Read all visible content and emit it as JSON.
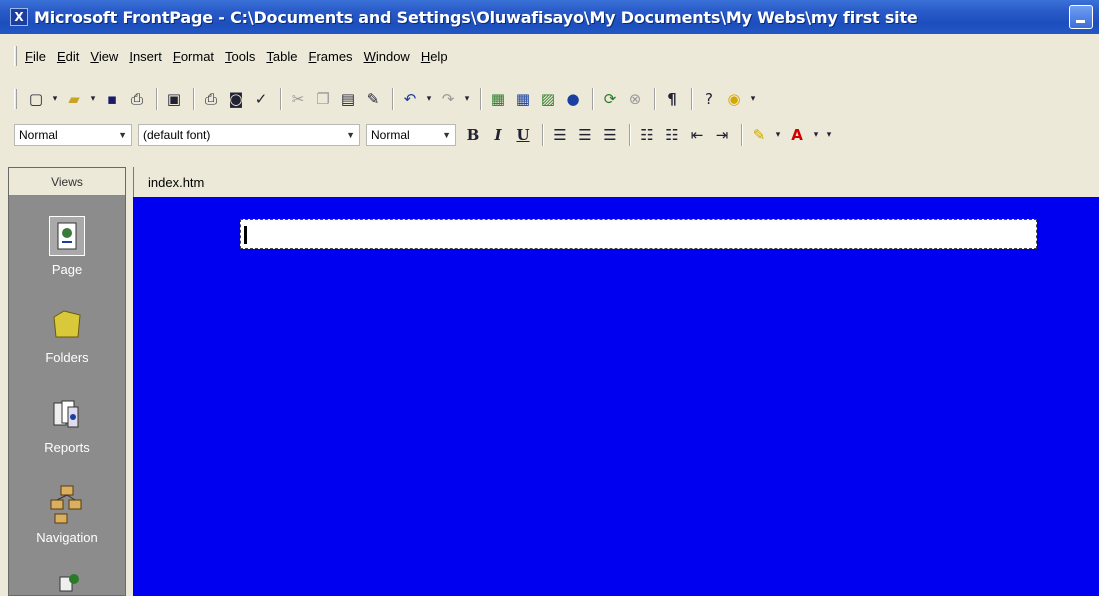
{
  "window": {
    "title": "Microsoft FrontPage - C:\\Documents and Settings\\Oluwafisayo\\My Documents\\My Webs\\my first site"
  },
  "menu": [
    "File",
    "Edit",
    "View",
    "Insert",
    "Format",
    "Tools",
    "Table",
    "Frames",
    "Window",
    "Help"
  ],
  "formatting": {
    "style": "Normal",
    "font": "(default font)",
    "size": "Normal",
    "bold": "B",
    "italic": "I",
    "underline": "U"
  },
  "views": {
    "header": "Views",
    "items": [
      {
        "label": "Page",
        "icon": "page-icon"
      },
      {
        "label": "Folders",
        "icon": "folder-icon"
      },
      {
        "label": "Reports",
        "icon": "reports-icon"
      },
      {
        "label": "Navigation",
        "icon": "navigation-icon"
      },
      {
        "label": "",
        "icon": "hyperlinks-icon"
      }
    ]
  },
  "editor": {
    "tab": "index.htm",
    "background_color": "#0000f0"
  }
}
